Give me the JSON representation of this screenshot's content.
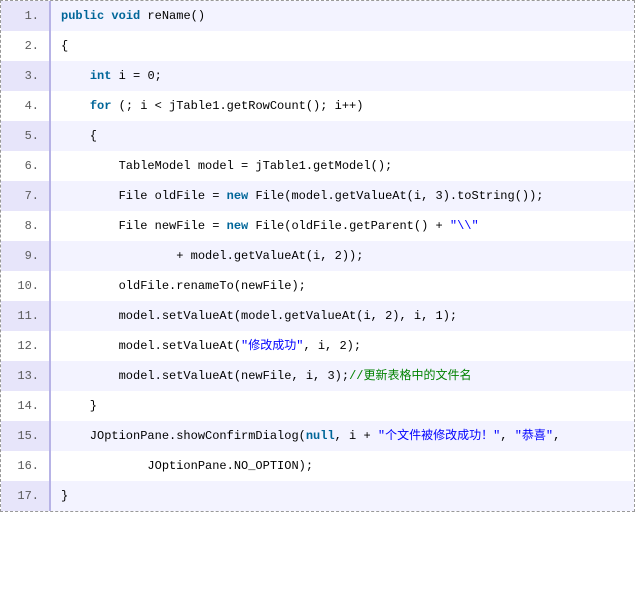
{
  "code": {
    "lines": [
      {
        "num": "1.",
        "tokens": [
          {
            "t": "kw",
            "v": "public"
          },
          {
            "t": "plain",
            "v": " "
          },
          {
            "t": "kw",
            "v": "void"
          },
          {
            "t": "plain",
            "v": " reName()"
          }
        ]
      },
      {
        "num": "2.",
        "tokens": [
          {
            "t": "plain",
            "v": "{"
          }
        ]
      },
      {
        "num": "3.",
        "tokens": [
          {
            "t": "plain",
            "v": "    "
          },
          {
            "t": "kw",
            "v": "int"
          },
          {
            "t": "plain",
            "v": " i = "
          },
          {
            "t": "num",
            "v": "0"
          },
          {
            "t": "plain",
            "v": ";"
          }
        ]
      },
      {
        "num": "4.",
        "tokens": [
          {
            "t": "plain",
            "v": "    "
          },
          {
            "t": "kw",
            "v": "for"
          },
          {
            "t": "plain",
            "v": " (; i < jTable1.getRowCount(); i++)"
          }
        ]
      },
      {
        "num": "5.",
        "tokens": [
          {
            "t": "plain",
            "v": "    {"
          }
        ]
      },
      {
        "num": "6.",
        "tokens": [
          {
            "t": "plain",
            "v": "        TableModel model = jTable1.getModel();"
          }
        ]
      },
      {
        "num": "7.",
        "tokens": [
          {
            "t": "plain",
            "v": "        File oldFile = "
          },
          {
            "t": "kw",
            "v": "new"
          },
          {
            "t": "plain",
            "v": " File(model.getValueAt(i, "
          },
          {
            "t": "num",
            "v": "3"
          },
          {
            "t": "plain",
            "v": ").toString());"
          }
        ]
      },
      {
        "num": "8.",
        "tokens": [
          {
            "t": "plain",
            "v": "        File newFile = "
          },
          {
            "t": "kw",
            "v": "new"
          },
          {
            "t": "plain",
            "v": " File(oldFile.getParent() + "
          },
          {
            "t": "str",
            "v": "\"\\\\\""
          }
        ]
      },
      {
        "num": "9.",
        "tokens": [
          {
            "t": "plain",
            "v": "                + model.getValueAt(i, "
          },
          {
            "t": "num",
            "v": "2"
          },
          {
            "t": "plain",
            "v": "));"
          }
        ]
      },
      {
        "num": "10.",
        "tokens": [
          {
            "t": "plain",
            "v": "        oldFile.renameTo(newFile);"
          }
        ]
      },
      {
        "num": "11.",
        "tokens": [
          {
            "t": "plain",
            "v": "        model.setValueAt(model.getValueAt(i, "
          },
          {
            "t": "num",
            "v": "2"
          },
          {
            "t": "plain",
            "v": "), i, "
          },
          {
            "t": "num",
            "v": "1"
          },
          {
            "t": "plain",
            "v": ");"
          }
        ]
      },
      {
        "num": "12.",
        "tokens": [
          {
            "t": "plain",
            "v": "        model.setValueAt("
          },
          {
            "t": "str",
            "v": "\"修改成功\""
          },
          {
            "t": "plain",
            "v": ", i, "
          },
          {
            "t": "num",
            "v": "2"
          },
          {
            "t": "plain",
            "v": ");"
          }
        ]
      },
      {
        "num": "13.",
        "tokens": [
          {
            "t": "plain",
            "v": "        model.setValueAt(newFile, i, "
          },
          {
            "t": "num",
            "v": "3"
          },
          {
            "t": "plain",
            "v": ");"
          },
          {
            "t": "cmt",
            "v": "//更新表格中的文件名"
          }
        ]
      },
      {
        "num": "14.",
        "tokens": [
          {
            "t": "plain",
            "v": "    }"
          }
        ]
      },
      {
        "num": "15.",
        "tokens": [
          {
            "t": "plain",
            "v": "    JOptionPane.showConfirmDialog("
          },
          {
            "t": "kw",
            "v": "null"
          },
          {
            "t": "plain",
            "v": ", i + "
          },
          {
            "t": "str",
            "v": "\"个文件被修改成功！\""
          },
          {
            "t": "plain",
            "v": ", "
          },
          {
            "t": "str",
            "v": "\"恭喜\""
          },
          {
            "t": "plain",
            "v": ","
          }
        ]
      },
      {
        "num": "16.",
        "tokens": [
          {
            "t": "plain",
            "v": "            JOptionPane.NO_OPTION);"
          }
        ]
      },
      {
        "num": "17.",
        "tokens": [
          {
            "t": "plain",
            "v": "}"
          }
        ]
      }
    ]
  }
}
